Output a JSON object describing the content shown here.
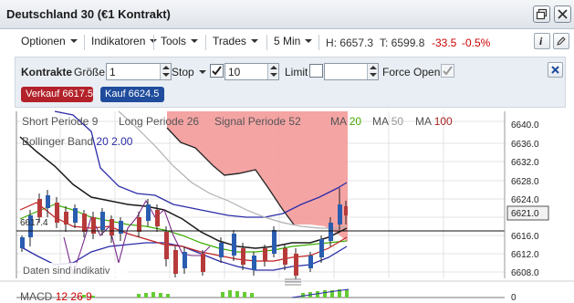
{
  "window": {
    "title": "Deutschland 30 (€1 Kontrakt)"
  },
  "menu": {
    "items": [
      "Optionen",
      "Indikatoren",
      "Tools",
      "Trades",
      "5 Min"
    ],
    "high": "H: 6657.3",
    "low": "T: 6599.8",
    "change": "-33.5",
    "change_pct": "-0.5%",
    "negative_color": "#cc0000"
  },
  "order": {
    "kontrakte_label": "Kontrakte",
    "groesse_label": "Größe",
    "groesse_value": "1",
    "stop_label": "Stop",
    "stop_checked": true,
    "stop_value": "10",
    "limit_label": "Limit",
    "limit_checked": false,
    "limit_value": "",
    "force_open_label": "Force Open",
    "force_open_checked": true,
    "sell_label": "Verkauf 6617.5",
    "buy_label": "Kauf 6624.5",
    "sell_color": "#b3222a",
    "buy_color": "#1f4c9c"
  },
  "chart": {
    "overlay_line1": {
      "short_label": "Short Periode",
      "short_value": "9",
      "long_label": "Long Periode",
      "long_value": "26",
      "signal_label": "Signal Periode",
      "signal_value": "52",
      "ma1_label": "MA",
      "ma1_value": "20",
      "ma2_label": "MA",
      "ma2_value": "50",
      "ma3_label": "MA",
      "ma3_value": "100"
    },
    "overlay_line2": {
      "bb_label": "Bollinger Band",
      "bb_period": "20",
      "bb_dev": "2.00"
    },
    "ma_colors": {
      "ma20": "#44aa00",
      "ma50": "#999999",
      "ma100": "#aa2222"
    },
    "indicative_note": "Daten sind indikativ",
    "current_price": "6621.0",
    "y_ticks": [
      "6640.0",
      "6636.0",
      "6632.0",
      "6628.0",
      "6624.0",
      "6620.0",
      "6616.0",
      "6612.0",
      "6608.0"
    ],
    "left_price_marker": "6617.4"
  },
  "macd": {
    "label": "MACD",
    "v1": "12",
    "v2": "26",
    "v3": "9",
    "zero_label": "0"
  }
}
